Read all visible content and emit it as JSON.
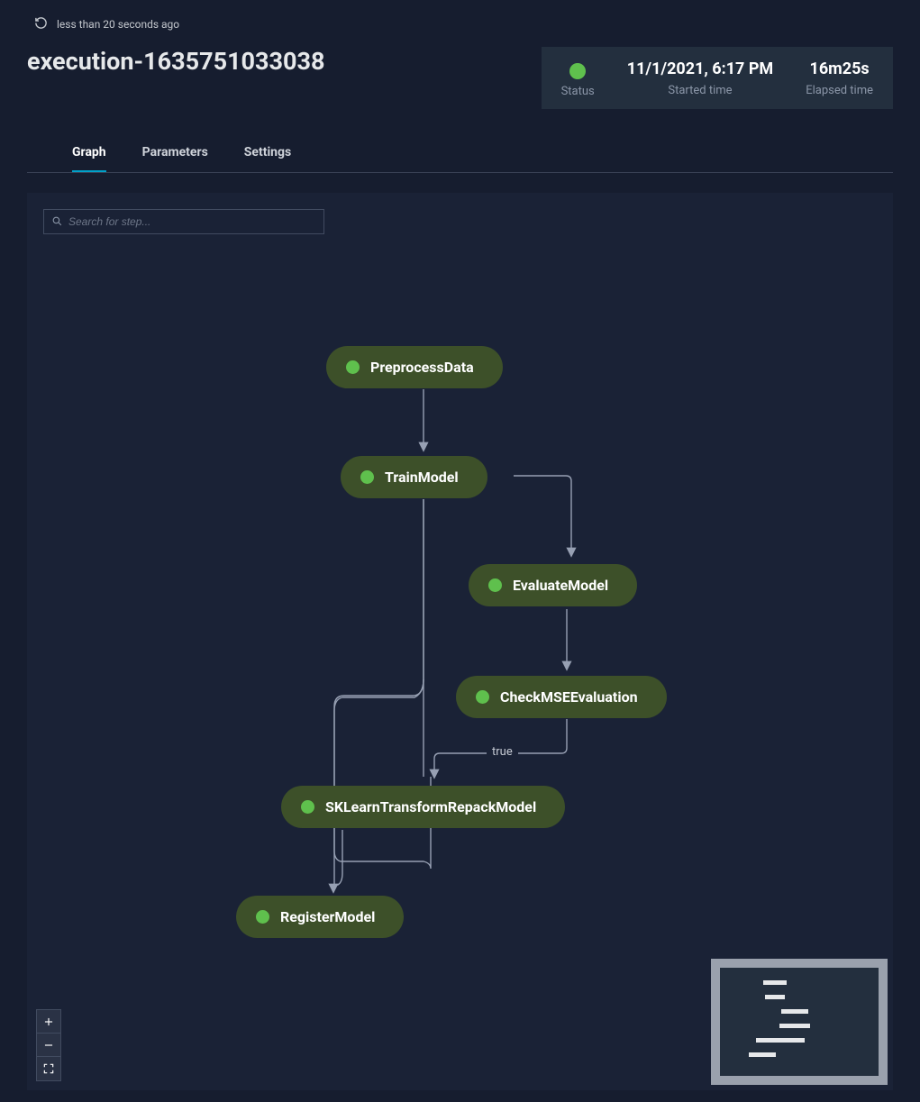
{
  "refresh": {
    "ago_text": "less than 20 seconds ago"
  },
  "header": {
    "title": "execution-1635751033038"
  },
  "status": {
    "status_label": "Status",
    "started_time_label": "Started time",
    "elapsed_label": "Elapsed time",
    "started_time": "11/1/2021, 6:17 PM",
    "elapsed": "16m25s"
  },
  "tabs": {
    "graph": "Graph",
    "parameters": "Parameters",
    "settings": "Settings"
  },
  "search": {
    "placeholder": "Search for step..."
  },
  "nodes": {
    "preprocess": "PreprocessData",
    "train": "TrainModel",
    "evaluate": "EvaluateModel",
    "checkmse": "CheckMSEEvaluation",
    "repack": "SKLearnTransformRepackModel",
    "register": "RegisterModel"
  },
  "edge_labels": {
    "true": "true"
  },
  "colors": {
    "status_ok": "#5fc04d",
    "accent": "#00a1c9"
  }
}
